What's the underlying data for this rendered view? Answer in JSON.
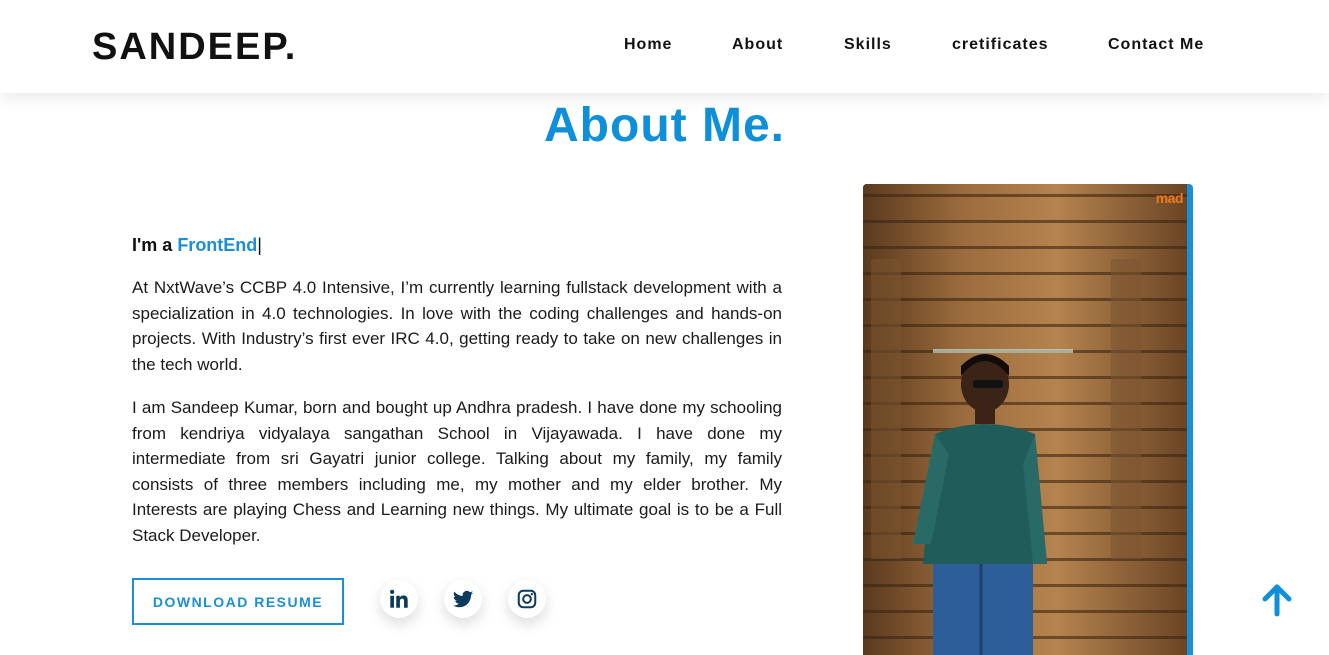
{
  "brand": {
    "logo": "SANDEEP."
  },
  "nav": {
    "items": [
      {
        "label": "Home"
      },
      {
        "label": "About"
      },
      {
        "label": "Skills"
      },
      {
        "label": "cretificates"
      },
      {
        "label": "Contact Me"
      }
    ]
  },
  "about": {
    "title": "About Me.",
    "intro_prefix": "I'm a ",
    "intro_role": "FrontEnd",
    "intro_cursor": "|",
    "paragraph1": "At NxtWave’s CCBP 4.0 Intensive, I’m currently learning fullstack development with a specialization in 4.0 technologies. In love with the coding challenges and hands-on projects. With Industry’s first ever IRC 4.0, getting ready to take on new challenges in the tech world.",
    "paragraph2": "I am Sandeep Kumar, born and bought up Andhra pradesh. I have done my schooling from kendriya vidyalaya sangathan School in Vijayawada. I have done my intermediate from sri Gayatri junior college. Talking about my family, my family consists of three members including me, my mother and my elder brother. My Interests are playing Chess and Learning new things. My ultimate goal is to be a Full Stack Developer.",
    "download_label": "DOWNLOAD RESUME",
    "social": [
      {
        "name": "linkedin-icon"
      },
      {
        "name": "twitter-icon"
      },
      {
        "name": "instagram-icon"
      }
    ],
    "photo_watermark": "mad"
  },
  "colors": {
    "accent": "#0d8fd9",
    "social_icon": "#0b3a5c",
    "watermark": "#f07a1a"
  }
}
